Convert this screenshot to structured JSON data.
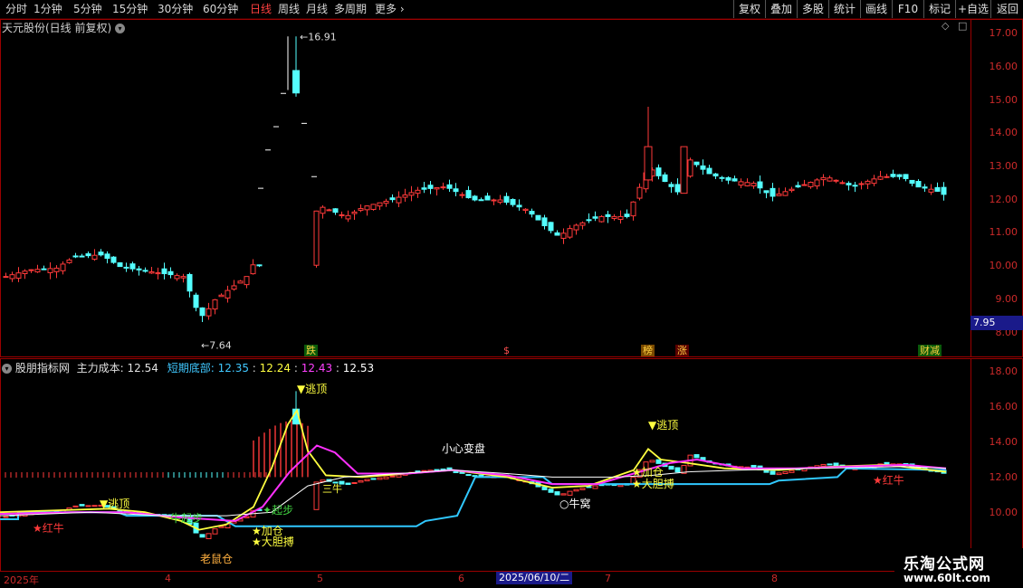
{
  "topbar": {
    "periods": [
      "分时",
      "1分钟",
      "5分钟",
      "15分钟",
      "30分钟",
      "60分钟",
      "日线",
      "周线",
      "月线",
      "多周期",
      "更多"
    ],
    "active": "日线",
    "buttons": [
      "复权",
      "叠加",
      "多股",
      "统计",
      "画线",
      "F10",
      "标记",
      "+自选",
      "返回"
    ]
  },
  "main": {
    "title": "天元股份(日线 前复权)",
    "ticks": [
      "17.00",
      "16.00",
      "15.00",
      "14.00",
      "13.00",
      "12.00",
      "11.00",
      "10.00",
      "9.00",
      "8.00"
    ],
    "price_box": "7.95",
    "high_label": "16.91",
    "low_label": "7.64",
    "markers": [
      "跌",
      "$",
      "榜",
      "涨",
      "财减"
    ]
  },
  "sub": {
    "title": "股朋指标网",
    "main_cost_label": "主力成本:",
    "main_cost": "12.54",
    "bottom_label": "短期底部:",
    "v1": "12.35",
    "v2": "12.24",
    "v3": "12.43",
    "v4": "12.53",
    "ticks": [
      "18.00",
      "16.00",
      "14.00",
      "12.00",
      "10.00"
    ],
    "annotations": [
      "逃顶",
      "逃顶",
      "逃顶",
      "小心变盘",
      "红牛",
      "红牛",
      "牛起步",
      "起步",
      "加仓",
      "加仓",
      "大胆搏",
      "大胆搏",
      "老鼠仓",
      "牛窝",
      "三牛"
    ]
  },
  "datebar": {
    "year": "2025年",
    "months": [
      "4",
      "5",
      "6",
      "7",
      "8"
    ],
    "cursor_date": "2025/06/10/二"
  },
  "watermark": {
    "line1": "乐淘公式网",
    "line2": "www.60lt.com"
  },
  "colors": {
    "up": "#ff3a3a",
    "down": "#54ffff",
    "frame": "#9b0000",
    "axis_text": "#cc2a2a"
  }
}
